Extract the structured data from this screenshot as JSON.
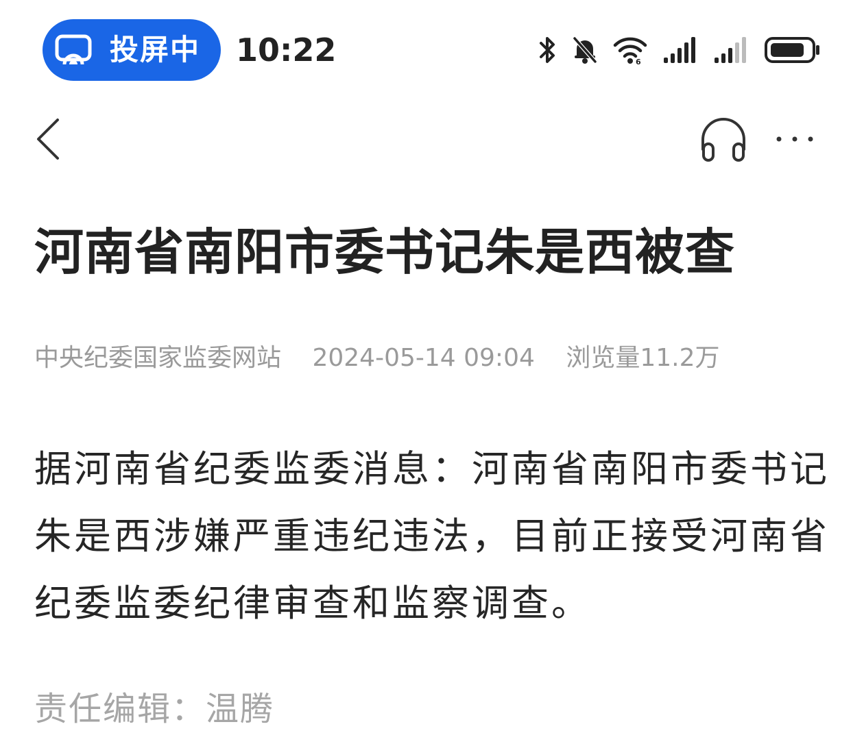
{
  "status_bar": {
    "cast_label": "投屏中",
    "time": "10:22",
    "icons": [
      "cast-icon",
      "bluetooth-icon",
      "mute-icon",
      "wifi-icon",
      "signal-icon",
      "signal-icon",
      "battery-icon"
    ],
    "cast_color": "#1a66e6"
  },
  "nav": {
    "icons": [
      "back-icon",
      "headphones-icon",
      "more-icon"
    ]
  },
  "article": {
    "title": "河南省南阳市委书记朱是西被查",
    "source": "中央纪委国家监委网站",
    "datetime": "2024-05-14 09:04",
    "views": "浏览量11.2万",
    "body": "据河南省纪委监委消息：河南省南阳市委书记朱是西涉嫌严重违纪违法，目前正接受河南省纪委监委纪律审查和监察调查。",
    "editor": "责任编辑：温腾"
  }
}
